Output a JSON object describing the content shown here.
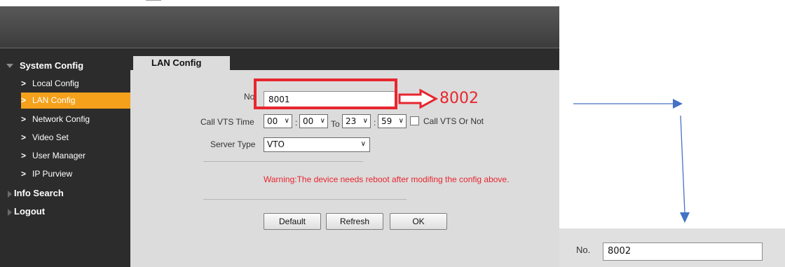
{
  "sidebar": {
    "system_config": "System Config",
    "items": [
      {
        "label": "Local Config"
      },
      {
        "label": "LAN Config"
      },
      {
        "label": "Network Config"
      },
      {
        "label": "Video Set"
      },
      {
        "label": "User Manager"
      },
      {
        "label": "IP Purview"
      }
    ],
    "info_search": "Info Search",
    "logout": "Logout",
    "item_chevron": ">"
  },
  "tab": {
    "label": "LAN Config"
  },
  "form": {
    "no_label": "No.",
    "no_value": "8001",
    "call_vts_label": "Call VTS Time",
    "start_hour": "00",
    "start_minute": "00",
    "to_label": "To",
    "end_hour": "23",
    "end_minute": "59",
    "colon": ":",
    "call_vts_or_not_label": "Call VTS Or Not",
    "call_vts_or_not_checked": false,
    "server_type_label": "Server Type",
    "server_type_value": "VTO",
    "dropdown_glyph": "∨"
  },
  "warning": "Warning:The device needs reboot after modifing the config above.",
  "buttons": {
    "default": "Default",
    "refresh": "Refresh",
    "ok": "OK"
  },
  "annotation": {
    "new_value": "8002"
  },
  "inset": {
    "no_label": "No.",
    "no_value": "8002"
  },
  "colors": {
    "accent": "#f5a11b",
    "warning": "#e8262e",
    "annotation_red": "#e8262e",
    "arrow_blue": "#4472c4"
  }
}
